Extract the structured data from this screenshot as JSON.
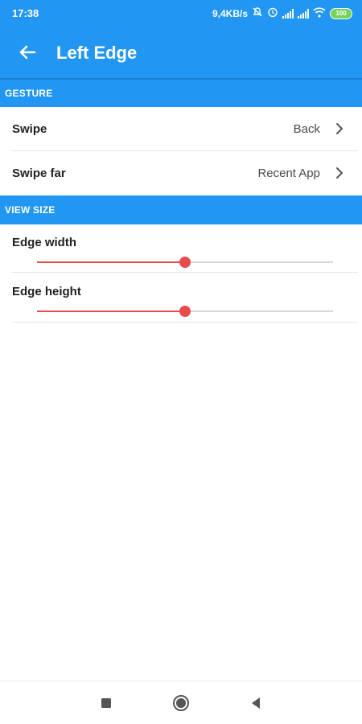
{
  "status_bar": {
    "time": "17:38",
    "network_speed": "9,4KB/s",
    "battery_level": "100",
    "icons": [
      "mute-icon",
      "alarm-icon",
      "signal-icon",
      "signal-icon",
      "wifi-icon",
      "battery-icon"
    ]
  },
  "app_bar": {
    "title": "Left Edge",
    "back_icon": "arrow-left-icon",
    "color": "#2196F3"
  },
  "sections": {
    "gesture": {
      "header": "GESTURE",
      "rows": [
        {
          "label": "Swipe",
          "value": "Back"
        },
        {
          "label": "Swipe far",
          "value": "Recent App"
        }
      ]
    },
    "view_size": {
      "header": "VIEW SIZE",
      "sliders": [
        {
          "label": "Edge width",
          "level": 0.5
        },
        {
          "label": "Edge height",
          "level": 0.5
        }
      ]
    }
  },
  "slider_color": "#e84b4b",
  "nav_bar": {
    "icons": [
      "recents-square-icon",
      "home-circle-icon",
      "back-triangle-icon"
    ]
  }
}
